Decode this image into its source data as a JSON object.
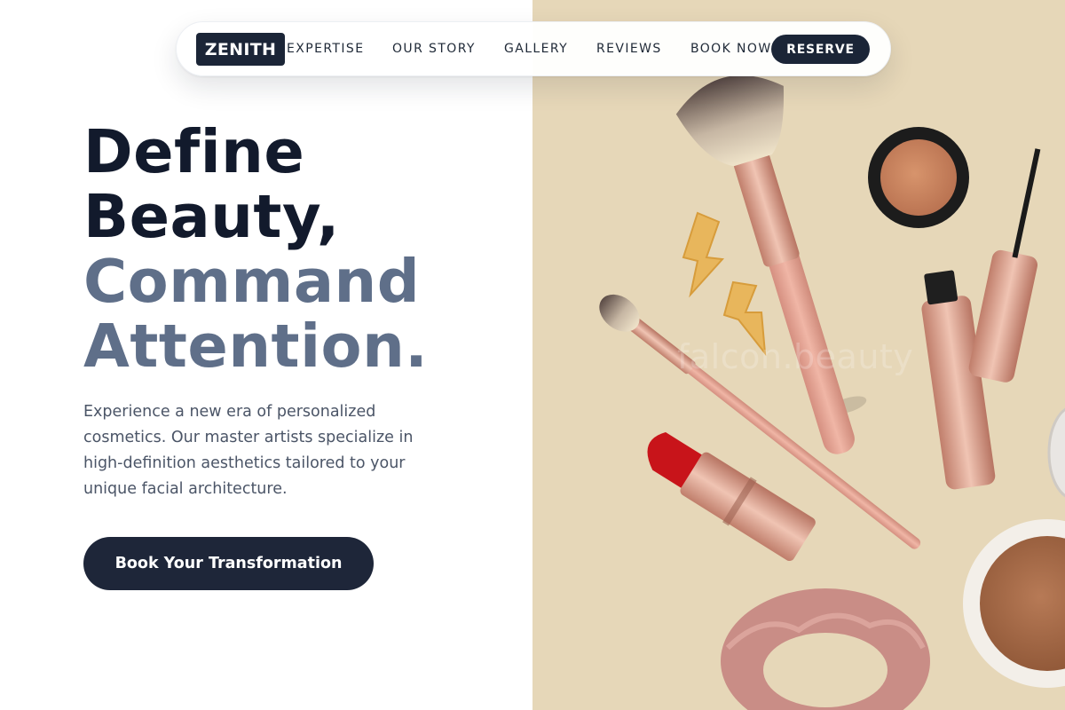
{
  "brand": {
    "logo_text": "ZENITH"
  },
  "nav": {
    "links": [
      "EXPERTISE",
      "OUR STORY",
      "GALLERY",
      "REVIEWS",
      "BOOK NOW"
    ],
    "reserve_label": "RESERVE"
  },
  "hero": {
    "headline_line1": "Define",
    "headline_line2": "Beauty,",
    "headline_line3": "Command",
    "headline_line4": "Attention.",
    "description": "Experience a new era of personalized cosmetics. Our master artists specialize in high-definition aesthetics tailored to your unique facial architecture.",
    "cta_label": "Book Your Transformation"
  },
  "image": {
    "watermark": "falcon.beauty"
  },
  "colors": {
    "navy": "#1b2537",
    "headline_dark": "#121a2c",
    "headline_muted": "#5f6f89",
    "image_background": "#e6d7b8",
    "rose_gold": "#d9a391"
  }
}
